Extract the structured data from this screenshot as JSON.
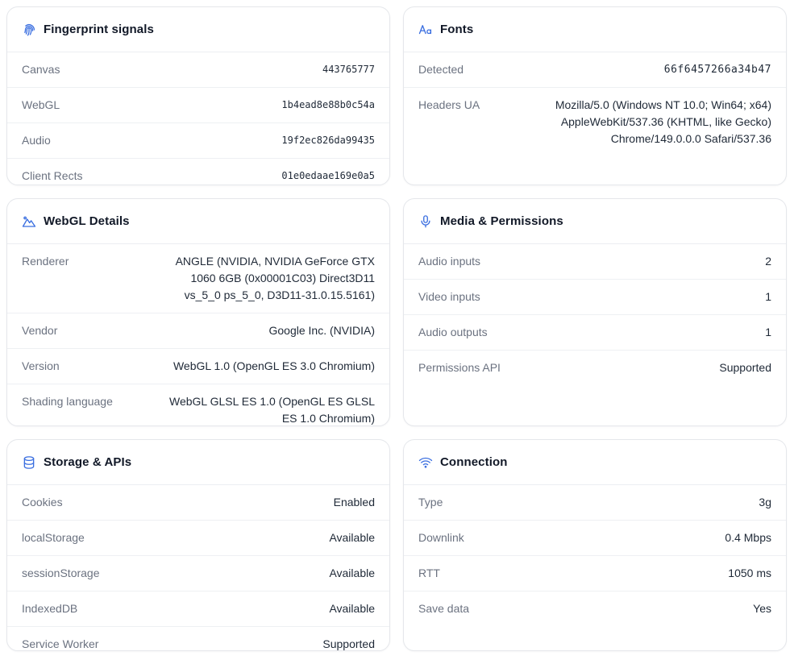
{
  "fingerprint": {
    "title": "Fingerprint signals",
    "rows": [
      {
        "label": "Canvas",
        "value": "443765777"
      },
      {
        "label": "WebGL",
        "value": "1b4ead8e88b0c54a"
      },
      {
        "label": "Audio",
        "value": "19f2ec826da99435"
      },
      {
        "label": "Client Rects",
        "value": "01e0edaae169e0a5"
      }
    ]
  },
  "fonts": {
    "title": "Fonts",
    "rows": [
      {
        "label": "Detected",
        "value": "66f6457266a34b47"
      },
      {
        "label": "Headers UA",
        "value": "Mozilla/5.0 (Windows NT 10.0; Win64; x64) AppleWebKit/537.36 (KHTML, like Gecko) Chrome/149.0.0.0 Safari/537.36"
      }
    ]
  },
  "webgl": {
    "title": "WebGL Details",
    "rows": [
      {
        "label": "Renderer",
        "value": "ANGLE (NVIDIA, NVIDIA GeForce GTX 1060 6GB (0x00001C03) Direct3D11 vs_5_0 ps_5_0, D3D11-31.0.15.5161)"
      },
      {
        "label": "Vendor",
        "value": "Google Inc. (NVIDIA)"
      },
      {
        "label": "Version",
        "value": "WebGL 1.0 (OpenGL ES 3.0 Chromium)"
      },
      {
        "label": "Shading language",
        "value": "WebGL GLSL ES 1.0 (OpenGL ES GLSL ES 1.0 Chromium)"
      }
    ]
  },
  "media": {
    "title": "Media & Permissions",
    "rows": [
      {
        "label": "Audio inputs",
        "value": "2"
      },
      {
        "label": "Video inputs",
        "value": "1"
      },
      {
        "label": "Audio outputs",
        "value": "1"
      },
      {
        "label": "Permissions API",
        "value": "Supported"
      }
    ]
  },
  "storage": {
    "title": "Storage & APIs",
    "rows": [
      {
        "label": "Cookies",
        "value": "Enabled"
      },
      {
        "label": "localStorage",
        "value": "Available"
      },
      {
        "label": "sessionStorage",
        "value": "Available"
      },
      {
        "label": "IndexedDB",
        "value": "Available"
      },
      {
        "label": "Service Worker",
        "value": "Supported"
      }
    ]
  },
  "connection": {
    "title": "Connection",
    "rows": [
      {
        "label": "Type",
        "value": "3g"
      },
      {
        "label": "Downlink",
        "value": "0.4 Mbps"
      },
      {
        "label": "RTT",
        "value": "1050 ms"
      },
      {
        "label": "Save data",
        "value": "Yes"
      }
    ]
  },
  "accent_color": "#3b6fe0",
  "icons": {
    "fingerprint": "fingerprint-icon",
    "fonts": "font-icon",
    "webgl": "mountain-icon",
    "media": "microphone-icon",
    "storage": "database-icon",
    "connection": "wifi-icon"
  }
}
